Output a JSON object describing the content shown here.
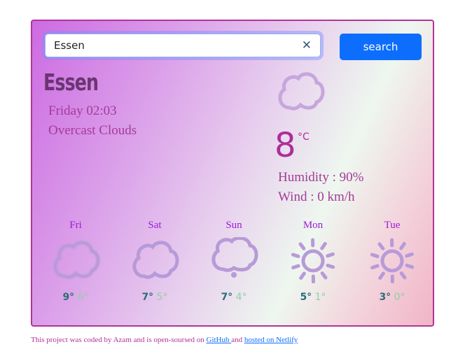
{
  "search": {
    "value": "Essen",
    "clear_icon": "close-icon",
    "button_label": "search"
  },
  "current": {
    "city": "Essen",
    "datetime": "Friday 02:03",
    "description": "Overcast Clouds",
    "icon": "cloud-icon",
    "temperature": "8",
    "unit": "°C",
    "humidity": "Humidity : 90%",
    "wind": "Wind : 0 km/h"
  },
  "forecast": [
    {
      "day": "Fri",
      "icon": "cloud-icon",
      "max": "9°",
      "min": "6°"
    },
    {
      "day": "Sat",
      "icon": "cloud-icon",
      "max": "7°",
      "min": "5°"
    },
    {
      "day": "Sun",
      "icon": "cloud-drizzle-icon",
      "max": "7°",
      "min": "4°"
    },
    {
      "day": "Mon",
      "icon": "sun-icon",
      "max": "5°",
      "min": "1°"
    },
    {
      "day": "Tue",
      "icon": "sun-icon",
      "max": "3°",
      "min": "0°"
    }
  ],
  "footer": {
    "text": "This project was coded by Azam and is open-soursed on ",
    "github": "GitHub ",
    "and": "and ",
    "netlify": "hosted on Netlify"
  },
  "colors": {
    "border": "#b0339a",
    "button": "#0d6efd",
    "icon": "#b79ad8"
  }
}
